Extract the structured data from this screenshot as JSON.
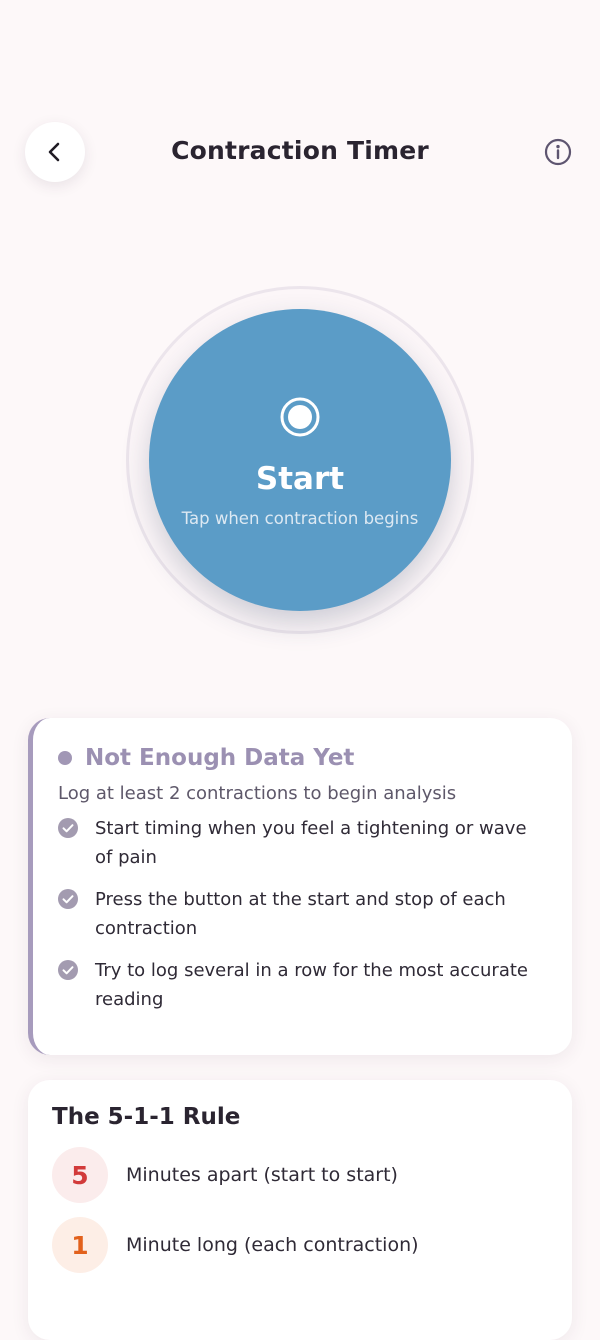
{
  "header": {
    "title": "Contraction Timer",
    "back_icon": "chevron-left-icon",
    "info_icon": "info-circle-icon"
  },
  "timer": {
    "button_label": "Start",
    "hint": "Tap when contraction begins",
    "icon": "record-icon",
    "color": "#5b9cc7"
  },
  "status": {
    "title": "Not Enough Data Yet",
    "subtitle": "Log at least 2 contractions to begin analysis",
    "accent_color": "#a79bbd",
    "tips": [
      {
        "text": "Start timing when you feel a tightening or wave of pain"
      },
      {
        "text": "Press the button at the start and stop of each contraction"
      },
      {
        "text": "Try to log several in a row for the most accurate reading"
      }
    ]
  },
  "rule": {
    "title": "The 5-1-1 Rule",
    "items": [
      {
        "number": "5",
        "text": "Minutes apart (start to start)",
        "color": "#d23b3b"
      },
      {
        "number": "1",
        "text": "Minute long (each contraction)",
        "color": "#e2611c"
      }
    ]
  }
}
